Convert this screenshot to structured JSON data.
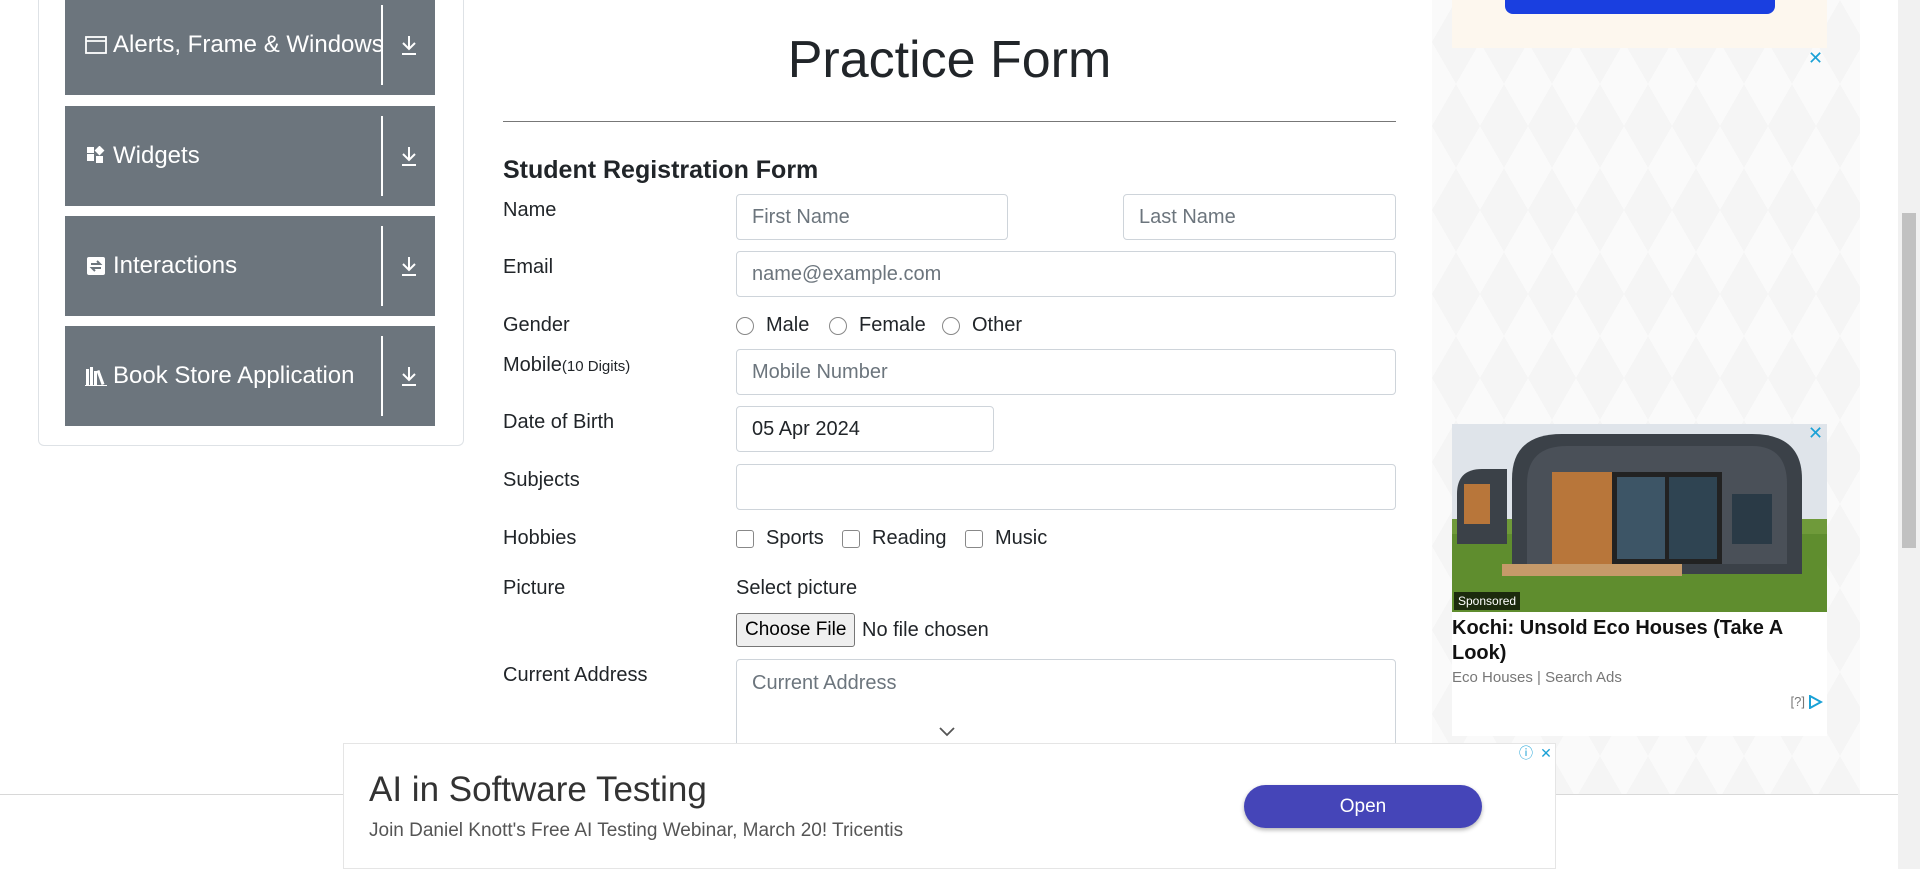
{
  "sidebar": {
    "groups": [
      {
        "label": "Alerts, Frame & Windows",
        "icon": "window-icon"
      },
      {
        "label": "Widgets",
        "icon": "widgets-icon"
      },
      {
        "label": "Interactions",
        "icon": "interactions-icon"
      },
      {
        "label": "Book Store Application",
        "icon": "books-icon"
      }
    ]
  },
  "form": {
    "page_title": "Practice Form",
    "heading": "Student Registration Form",
    "name_label": "Name",
    "first_name_placeholder": "First Name",
    "last_name_placeholder": "Last Name",
    "email_label": "Email",
    "email_placeholder": "name@example.com",
    "gender_label": "Gender",
    "genders": [
      "Male",
      "Female",
      "Other"
    ],
    "mobile_label": "Mobile",
    "mobile_hint": "(10 Digits)",
    "mobile_placeholder": "Mobile Number",
    "dob_label": "Date of Birth",
    "dob_value": "05 Apr 2024",
    "subjects_label": "Subjects",
    "hobbies_label": "Hobbies",
    "hobbies": [
      "Sports",
      "Reading",
      "Music"
    ],
    "picture_label": "Picture",
    "select_picture_text": "Select picture",
    "choose_file_label": "Choose File",
    "file_status": "No file chosen",
    "address_label": "Current Address",
    "address_placeholder": "Current Address"
  },
  "side_ad": {
    "sponsored": "Sponsored",
    "headline": "Kochi: Unsold Eco Houses (Take A Look)",
    "source": "Eco Houses | Search Ads",
    "choices": "[?]"
  },
  "banner_ad": {
    "title": "AI in Software Testing",
    "subtitle": "Join Daniel Knott's Free AI Testing Webinar, March 20! Tricentis",
    "open_label": "Open"
  },
  "colors": {
    "sidebar_group_bg": "#6c757d",
    "banner_button": "#4545b8",
    "ad_close": "#1aa1d6"
  }
}
